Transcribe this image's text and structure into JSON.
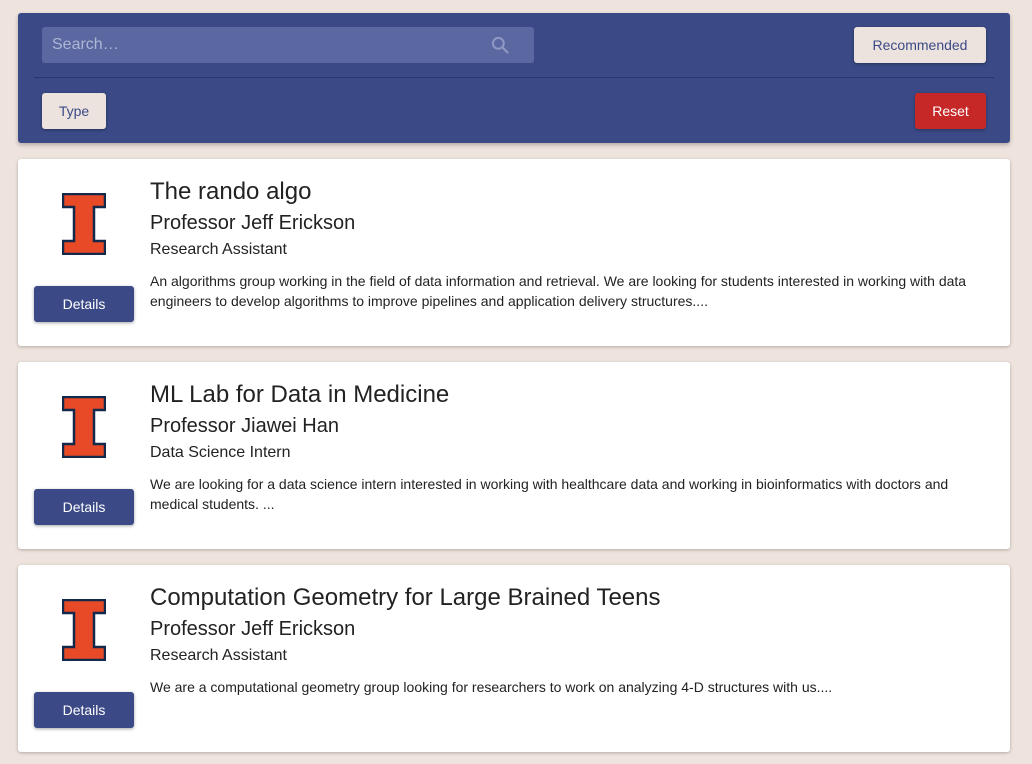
{
  "toolbar": {
    "search_placeholder": "Search…",
    "search_value": "",
    "sort_button_label": "Recommended",
    "filter_button_label": "Type",
    "reset_button_label": "Reset"
  },
  "colors": {
    "primary": "#3b4a87",
    "background": "#eee3dd",
    "reset": "#c62828",
    "logo_orange": "#e84a27",
    "logo_navy": "#13294b"
  },
  "listings": [
    {
      "logo_icon": "illinois-block-i-icon",
      "details_label": "Details",
      "title": "The rando algo",
      "professor": "Professor Jeff Erickson",
      "position": "Research Assistant",
      "description": "An algorithms group working in the field of data information and retrieval. We are looking for students interested in working with data engineers to develop algorithms to improve pipelines and application delivery structures...."
    },
    {
      "logo_icon": "illinois-block-i-icon",
      "details_label": "Details",
      "title": "ML Lab for Data in Medicine",
      "professor": "Professor Jiawei Han",
      "position": "Data Science Intern",
      "description": "We are looking for a data science intern interested in working with healthcare data and working in bioinformatics with doctors and medical students. ..."
    },
    {
      "logo_icon": "illinois-block-i-icon",
      "details_label": "Details",
      "title": "Computation Geometry for Large Brained Teens",
      "professor": "Professor Jeff Erickson",
      "position": "Research Assistant",
      "description": "We are a computational geometry group looking for researchers to work on analyzing 4-D structures with us...."
    }
  ]
}
